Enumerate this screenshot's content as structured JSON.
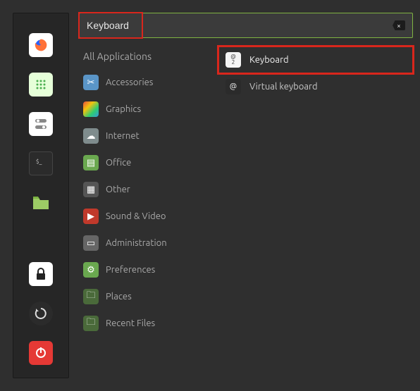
{
  "search": {
    "value": "Keyboard"
  },
  "launcher": {
    "items": [
      {
        "name": "firefox"
      },
      {
        "name": "apps-grid"
      },
      {
        "name": "settings-toggle"
      },
      {
        "name": "terminal"
      },
      {
        "name": "files"
      },
      {
        "name": "lock"
      },
      {
        "name": "restart"
      },
      {
        "name": "power"
      }
    ]
  },
  "categories": {
    "header": "All Applications",
    "items": [
      {
        "icon": "scissors",
        "label": "Accessories"
      },
      {
        "icon": "graphics",
        "label": "Graphics"
      },
      {
        "icon": "cloud",
        "label": "Internet"
      },
      {
        "icon": "office",
        "label": "Office"
      },
      {
        "icon": "grid",
        "label": "Other"
      },
      {
        "icon": "play",
        "label": "Sound & Video"
      },
      {
        "icon": "admin",
        "label": "Administration"
      },
      {
        "icon": "prefs",
        "label": "Preferences"
      },
      {
        "icon": "folder",
        "label": "Places"
      },
      {
        "icon": "recent",
        "label": "Recent Files"
      }
    ]
  },
  "results": [
    {
      "label": "Keyboard",
      "highlighted": true
    },
    {
      "label": "Virtual keyboard",
      "highlighted": false
    }
  ],
  "highlights": {
    "search_box": true,
    "first_result": true
  }
}
